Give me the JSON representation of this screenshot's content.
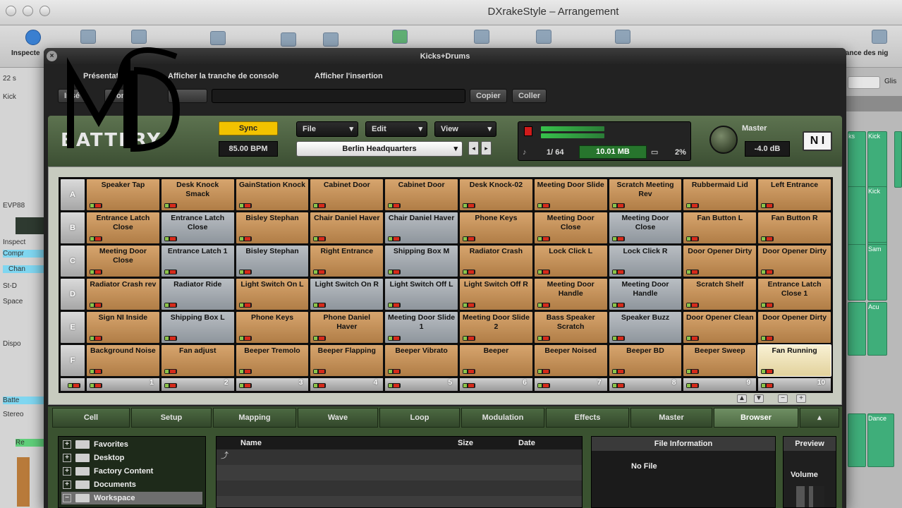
{
  "host": {
    "window_title": "DXrakeStyle – Arrangement",
    "toolbar_left": "Inspecte",
    "toolbar_right": "lance des nig",
    "left_labels": [
      "22 s",
      "Kick",
      "EVP88",
      "Inspect",
      "Compr",
      "Chan",
      "St-D",
      "Space",
      "Dispo",
      "Batte",
      "Stereo",
      "Re"
    ],
    "right_labels": [
      "Glis",
      "ks",
      "Kick",
      "Kick",
      "Sam",
      "Acu",
      "Dance"
    ]
  },
  "plugin": {
    "title": "Kicks+Drums",
    "close": "×",
    "menus": [
      "Présentation",
      "Afficher la tranche de console",
      "Afficher l'insertion"
    ],
    "toolbar2": {
      "insert": "Insé",
      "compare": "Com",
      "copy": "Copier",
      "paste": "Coller"
    },
    "sync": "Sync",
    "bpm": "85.00 BPM",
    "file_btn": "File",
    "edit_btn": "Edit",
    "view_btn": "View",
    "kit_name": "Berlin Headquarters",
    "voices": "1/ 64",
    "memory": "10.01 MB",
    "cpu": "2%",
    "master_label": "Master",
    "master_value": "-4.0 dB",
    "ni_logo": "N I",
    "logo_text": "BATTERY"
  },
  "grid": {
    "rows": [
      "A",
      "B",
      "C",
      "D",
      "E",
      "F"
    ],
    "cells": [
      [
        {
          "t": "Speaker Tap",
          "c": "o"
        },
        {
          "t": "Desk Knock Smack",
          "c": "o"
        },
        {
          "t": "GainStation Knock",
          "c": "o"
        },
        {
          "t": "Cabinet Door",
          "c": "o"
        },
        {
          "t": "Cabinet Door",
          "c": "o"
        },
        {
          "t": "Desk Knock-02",
          "c": "o"
        },
        {
          "t": "Meeting Door Slide",
          "c": "o"
        },
        {
          "t": "Scratch Meeting Rev",
          "c": "o"
        },
        {
          "t": "Rubbermaid Lid",
          "c": "o"
        },
        {
          "t": "Left Entrance",
          "c": "o"
        }
      ],
      [
        {
          "t": "Entrance Latch Close",
          "c": "o"
        },
        {
          "t": "Entrance Latch Close",
          "c": "g"
        },
        {
          "t": "Bisley Stephan",
          "c": "o"
        },
        {
          "t": "Chair Daniel Haver",
          "c": "o"
        },
        {
          "t": "Chair Daniel Haver",
          "c": "g"
        },
        {
          "t": "Phone Keys",
          "c": "o"
        },
        {
          "t": "Meeting Door Close",
          "c": "o"
        },
        {
          "t": "Meeting Door Close",
          "c": "g"
        },
        {
          "t": "Fan Button L",
          "c": "o"
        },
        {
          "t": "Fan Button R",
          "c": "o"
        }
      ],
      [
        {
          "t": "Meeting Door Close",
          "c": "o"
        },
        {
          "t": "Entrance Latch 1",
          "c": "g"
        },
        {
          "t": "Bisley Stephan",
          "c": "g"
        },
        {
          "t": "Right Entrance",
          "c": "o"
        },
        {
          "t": "Shipping Box M",
          "c": "g"
        },
        {
          "t": "Radiator Crash",
          "c": "o"
        },
        {
          "t": "Lock Click L",
          "c": "o"
        },
        {
          "t": "Lock Click R",
          "c": "g"
        },
        {
          "t": "Door Opener Dirty",
          "c": "o"
        },
        {
          "t": "Door Opener Dirty",
          "c": "o"
        }
      ],
      [
        {
          "t": "Radiator Crash rev",
          "c": "o"
        },
        {
          "t": "Radiator Ride",
          "c": "g"
        },
        {
          "t": "Light Switch On L",
          "c": "o"
        },
        {
          "t": "Light Switch On R",
          "c": "g"
        },
        {
          "t": "Light Switch Off L",
          "c": "g"
        },
        {
          "t": "Light Switch Off R",
          "c": "o"
        },
        {
          "t": "Meeting Door Handle",
          "c": "o"
        },
        {
          "t": "Meeting Door Handle",
          "c": "g"
        },
        {
          "t": "Scratch Shelf",
          "c": "o"
        },
        {
          "t": "Entrance Latch Close 1",
          "c": "o"
        }
      ],
      [
        {
          "t": "Sign NI Inside",
          "c": "o"
        },
        {
          "t": "Shipping Box L",
          "c": "g"
        },
        {
          "t": "Phone Keys",
          "c": "o"
        },
        {
          "t": "Phone Daniel Haver",
          "c": "o"
        },
        {
          "t": "Meeting Door Slide 1",
          "c": "g"
        },
        {
          "t": "Meeting Door Slide 2",
          "c": "o"
        },
        {
          "t": "Bass Speaker Scratch",
          "c": "o"
        },
        {
          "t": "Speaker Buzz",
          "c": "g"
        },
        {
          "t": "Door Opener Clean",
          "c": "o"
        },
        {
          "t": "Door Opener Dirty",
          "c": "o"
        }
      ],
      [
        {
          "t": "Background Noise",
          "c": "o"
        },
        {
          "t": "Fan adjust",
          "c": "o"
        },
        {
          "t": "Beeper Tremolo",
          "c": "o"
        },
        {
          "t": "Beeper Flapping",
          "c": "o"
        },
        {
          "t": "Beeper Vibrato",
          "c": "o"
        },
        {
          "t": "Beeper",
          "c": "o"
        },
        {
          "t": "Beeper Noised",
          "c": "o"
        },
        {
          "t": "Beeper BD",
          "c": "o"
        },
        {
          "t": "Beeper Sweep",
          "c": "o"
        },
        {
          "t": "Fan Running",
          "c": "sel"
        }
      ]
    ],
    "columns": [
      "1",
      "2",
      "3",
      "4",
      "5",
      "6",
      "7",
      "8",
      "9",
      "10"
    ]
  },
  "tabs": [
    "Cell",
    "Setup",
    "Mapping",
    "Wave",
    "Loop",
    "Modulation",
    "Effects",
    "Master",
    "Browser"
  ],
  "browser": {
    "tree": [
      "Favorites",
      "Desktop",
      "Factory Content",
      "Documents",
      "Workspace"
    ],
    "columns": {
      "name": "Name",
      "size": "Size",
      "date": "Date"
    },
    "file_info_title": "File Information",
    "no_file": "No File",
    "preview": "Preview",
    "volume": "Volume"
  },
  "colors": {
    "orange_cell": "#c4915a",
    "grey_cell": "#a3a9af",
    "header_green": "#4c6340",
    "sync_yellow": "#f2c200"
  }
}
